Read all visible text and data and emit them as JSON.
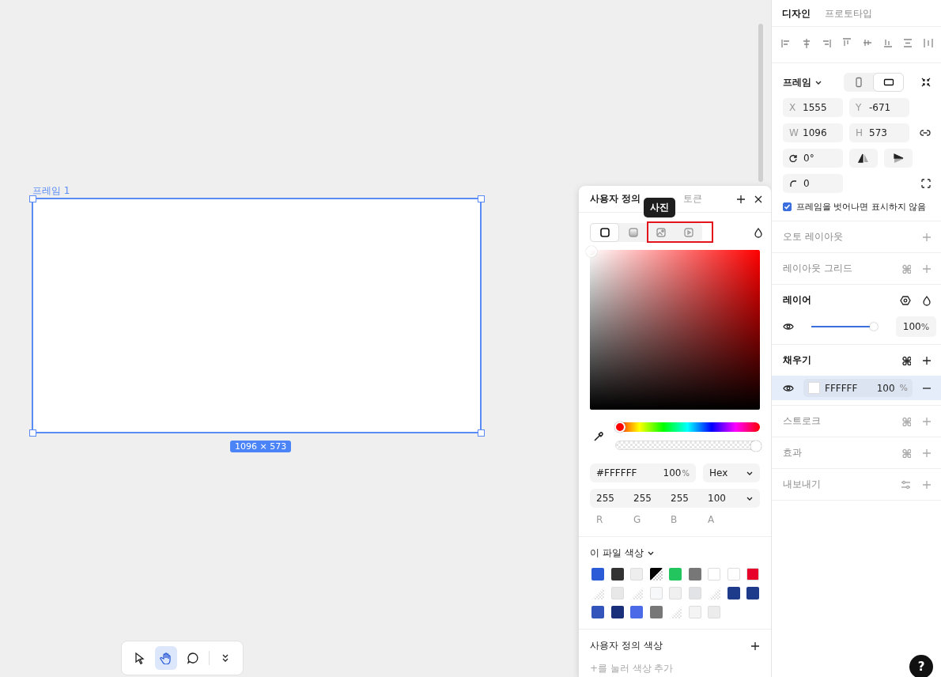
{
  "canvas": {
    "frame_label": "프레임 1",
    "size_badge": "1096 × 573"
  },
  "toolbar": {
    "tools": [
      {
        "kind": "pointer",
        "selected": false
      },
      {
        "kind": "hand",
        "selected": true
      },
      {
        "kind": "comment",
        "selected": false
      },
      {
        "kind": "more",
        "selected": false
      }
    ]
  },
  "color_picker": {
    "tabs": [
      {
        "label": "사용자 정의",
        "selected": true
      },
      {
        "label": "토큰",
        "selected": false
      }
    ],
    "fill_types": [
      {
        "kind": "solid",
        "selected": true
      },
      {
        "kind": "gradient",
        "selected": false
      },
      {
        "kind": "image",
        "selected": false
      },
      {
        "kind": "video",
        "selected": false
      }
    ],
    "tooltip": "사진",
    "hue": {
      "level": 0
    },
    "alpha": {
      "level": 1
    },
    "hex": "#FFFFFF",
    "opacity": "100",
    "opacity_unit": "%",
    "format": "Hex",
    "channels": [
      {
        "value": "255",
        "label": "R"
      },
      {
        "value": "255",
        "label": "G"
      },
      {
        "value": "255",
        "label": "B"
      },
      {
        "value": "100",
        "label": "A"
      }
    ],
    "file_colors": {
      "title": "이 파일 색상",
      "swatches": [
        {
          "kind": "solid",
          "color": "#2b5bd7"
        },
        {
          "kind": "solid",
          "color": "#333333"
        },
        {
          "kind": "solid",
          "color": "#eeeeee"
        },
        {
          "kind": "half",
          "color": "#000000"
        },
        {
          "kind": "solid",
          "color": "#22c55e"
        },
        {
          "kind": "solid",
          "color": "#777777"
        },
        {
          "kind": "solid",
          "color": "#ffffff"
        },
        {
          "kind": "solid",
          "color": "#ffffff"
        },
        {
          "kind": "solid",
          "color": "#e8002a"
        },
        {
          "kind": "clear",
          "color": "#ffffff"
        },
        {
          "kind": "solid",
          "color": "#e8e8e8"
        },
        {
          "kind": "clear",
          "color": "#ffffff"
        },
        {
          "kind": "solid",
          "color": "#f7f8fa"
        },
        {
          "kind": "solid",
          "color": "#f0f0f0"
        },
        {
          "kind": "solid",
          "color": "#e2e3e6"
        },
        {
          "kind": "clear",
          "color": "#ffffff"
        },
        {
          "kind": "solid",
          "color": "#1e3a8a"
        },
        {
          "kind": "solid",
          "color": "#1e3a8a"
        },
        {
          "kind": "solid",
          "color": "#3355bb"
        },
        {
          "kind": "solid",
          "color": "#1a2f7a"
        },
        {
          "kind": "solid",
          "color": "#4a6ae8"
        },
        {
          "kind": "solid",
          "color": "#777777"
        },
        {
          "kind": "clear",
          "color": "#ffffff"
        },
        {
          "kind": "solid",
          "color": "#f4f4f4"
        },
        {
          "kind": "solid",
          "color": "#ececec"
        }
      ]
    },
    "custom_colors": {
      "title": "사용자 정의 색상",
      "hint": "+를 눌러 색상 추가"
    }
  },
  "inspector": {
    "tabs": [
      {
        "label": "디자인",
        "selected": true
      },
      {
        "label": "프로토타입",
        "selected": false
      }
    ],
    "frame": {
      "title": "프레임",
      "orientations": [
        {
          "kind": "portrait",
          "selected": false
        },
        {
          "kind": "landscape",
          "selected": true
        }
      ],
      "fields": [
        {
          "label": "X",
          "value": "1555"
        },
        {
          "label": "Y",
          "value": "-671"
        },
        {
          "label": "W",
          "value": "1096"
        },
        {
          "label": "H",
          "value": "573"
        }
      ],
      "rotation": "0°",
      "radius": "0",
      "clip": {
        "label": "프레임을 벗어나면 표시하지 않음",
        "checked": true
      }
    },
    "sections": [
      {
        "kind": "empty",
        "title": "오토 레이아웃",
        "styles": false
      },
      {
        "kind": "empty",
        "title": "레이아웃 그리드",
        "styles": true
      },
      {
        "kind": "layer",
        "title": "레이어",
        "level": 0.97,
        "value": "100",
        "unit": "%"
      },
      {
        "kind": "fill",
        "title": "채우기",
        "styles": true,
        "fills": [
          {
            "hex": "FFFFFF",
            "color": "#ffffff",
            "opacity": "100",
            "unit": "%",
            "selected": true
          }
        ]
      },
      {
        "kind": "empty",
        "title": "스트로크",
        "styles": true
      },
      {
        "kind": "empty",
        "title": "효과",
        "styles": true
      },
      {
        "kind": "export",
        "title": "내보내기",
        "styles": false
      }
    ]
  },
  "help": "?"
}
